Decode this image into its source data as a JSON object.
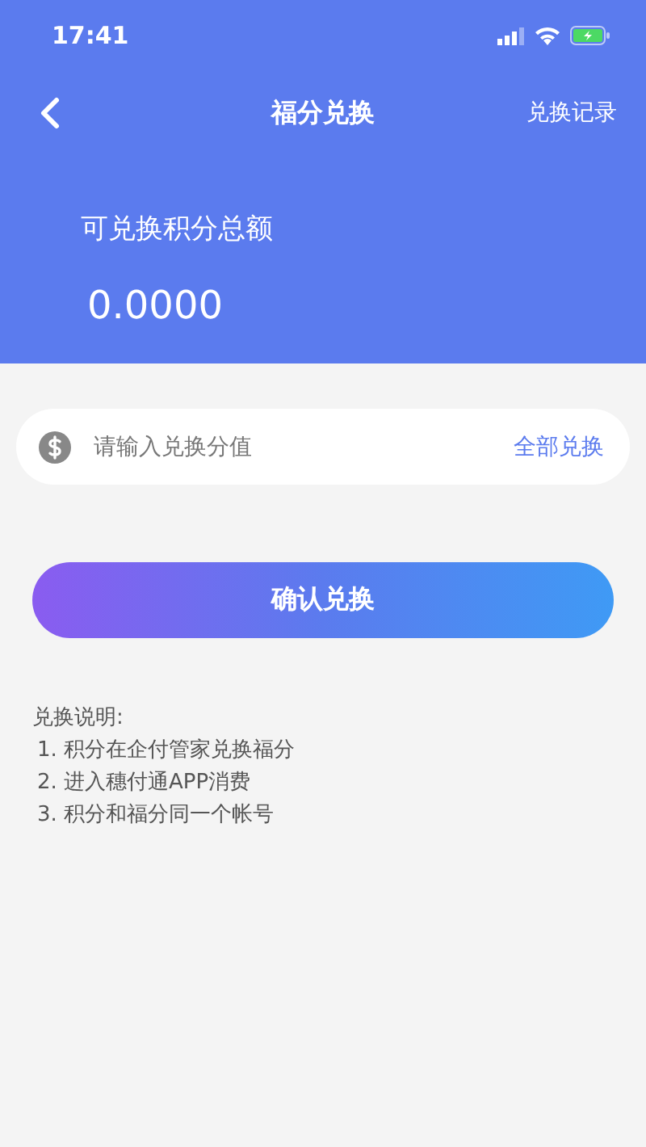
{
  "status_bar": {
    "time": "17:41"
  },
  "nav": {
    "title": "福分兑换",
    "action": "兑换记录"
  },
  "balance": {
    "label": "可兑换积分总额",
    "amount": "0.0000"
  },
  "exchange_field": {
    "placeholder": "请输入兑换分值",
    "action": "全部兑换"
  },
  "confirm_button": "确认兑换",
  "notes": {
    "heading": "兑换说明:",
    "items": [
      "1. 积分在企付管家兑换福分",
      "2. 进入穗付通APP消费",
      "3. 积分和福分同一个帐号"
    ]
  }
}
